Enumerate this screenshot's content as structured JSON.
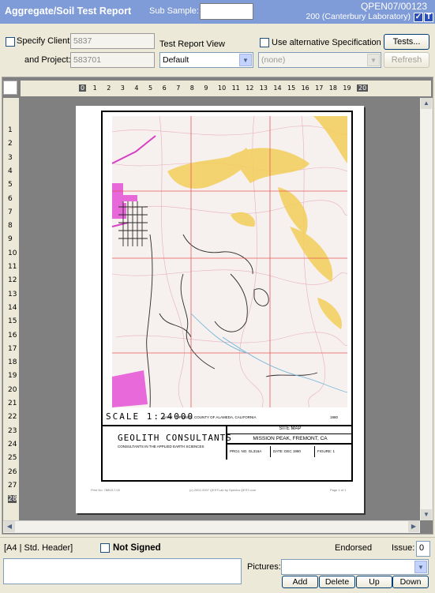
{
  "titlebar": {
    "title": "Aggregate/Soil Test Report",
    "sub_sample_label": "Sub Sample:",
    "sub_sample_value": "",
    "job_id": "QPEN07/00123",
    "lab": "200 (Canterbury Laboratory)",
    "check_glyph": "✓",
    "t_glyph": "T"
  },
  "options": {
    "specify_client_label": "Specify Client:",
    "client_value": "5837",
    "project_label": "and Project:",
    "project_value": "583701",
    "view_label": "Test Report View",
    "view_value": "Default",
    "alt_spec_label": "Use alternative Specification",
    "spec_value": "(none)",
    "tests_button": "Tests...",
    "refresh_button": "Refresh"
  },
  "ruler": {
    "h": [
      "0",
      "1",
      "2",
      "3",
      "4",
      "5",
      "6",
      "7",
      "8",
      "9",
      "10",
      "11",
      "12",
      "13",
      "14",
      "15",
      "16",
      "17",
      "18",
      "19",
      "20"
    ],
    "v": [
      "1",
      "2",
      "3",
      "4",
      "5",
      "6",
      "7",
      "8",
      "9",
      "10",
      "11",
      "12",
      "13",
      "14",
      "15",
      "16",
      "17",
      "18",
      "19",
      "20",
      "21",
      "22",
      "23",
      "24",
      "25",
      "26",
      "27",
      "28"
    ]
  },
  "document": {
    "scale_text": "SCALE 1:24000",
    "scale_note": "BASE: TOP USGS, COUNTY OF ALAMEDA, CALIFORNIA",
    "scale_year": "1980",
    "company": "GEOLITH CONSULTANTS",
    "company_tag": "CONSULTANTS IN THE APPLIED EARTH SCIENCES",
    "sheet_title": "SITE MAP",
    "location": "MISSION PEAK, FREMONT, CA",
    "proj_no": "PROJ. NO. GL316A",
    "date": "DATE: DEC 1990",
    "figure": "FIGURE: 1",
    "footer_left": "Print No: 7880/17-00",
    "footer_mid": "(c) 2002-2007  QESTLab by Spectra QEST.com",
    "footer_right": "Page 1 of 1"
  },
  "footer": {
    "std_header": "[A4 | Std. Header]",
    "not_signed": "Not Signed",
    "endorsed": "Endorsed",
    "issue_label": "Issue:",
    "issue_value": "0",
    "pictures_label": "Pictures:",
    "buttons": [
      "Add",
      "Delete",
      "Up",
      "Down"
    ]
  }
}
